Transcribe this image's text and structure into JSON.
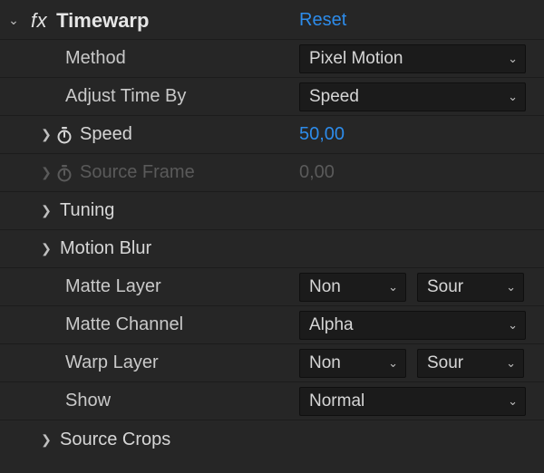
{
  "effect": {
    "fx_label": "fx",
    "name": "Timewarp",
    "reset": "Reset"
  },
  "props": {
    "method": {
      "label": "Method",
      "value": "Pixel Motion"
    },
    "adjust": {
      "label": "Adjust Time By",
      "value": "Speed"
    },
    "speed": {
      "label": "Speed",
      "value": "50,00"
    },
    "sourceFrame": {
      "label": "Source Frame",
      "value": "0,00"
    },
    "tuning": {
      "label": "Tuning"
    },
    "motionBlur": {
      "label": "Motion Blur"
    },
    "matteLayer": {
      "label": "Matte Layer",
      "value1": "Non",
      "value2": "Sour"
    },
    "matteChannel": {
      "label": "Matte Channel",
      "value": "Alpha"
    },
    "warpLayer": {
      "label": "Warp Layer",
      "value1": "Non",
      "value2": "Sour"
    },
    "show": {
      "label": "Show",
      "value": "Normal"
    },
    "sourceCrops": {
      "label": "Source Crops"
    }
  }
}
